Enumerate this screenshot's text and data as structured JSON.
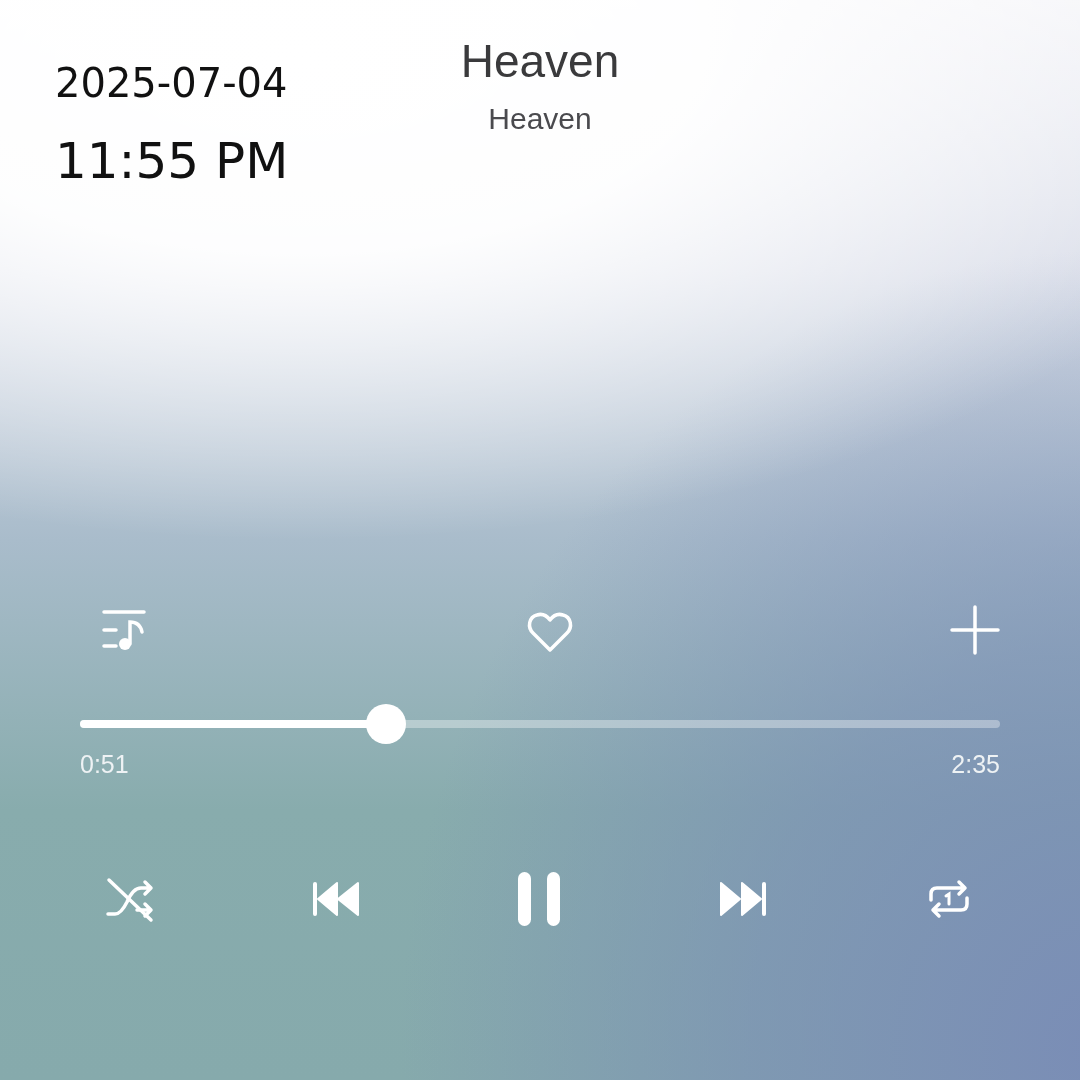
{
  "overlay": {
    "date": "2025-07-04",
    "time": "11:55 PM"
  },
  "track": {
    "title": "Heaven",
    "artist": "Heaven",
    "liked": false
  },
  "progress": {
    "level": 0.333,
    "elapsed": "0:51",
    "duration": "2:35"
  },
  "controls": {
    "shuffle": false,
    "playing": true,
    "repeat_one": true
  }
}
